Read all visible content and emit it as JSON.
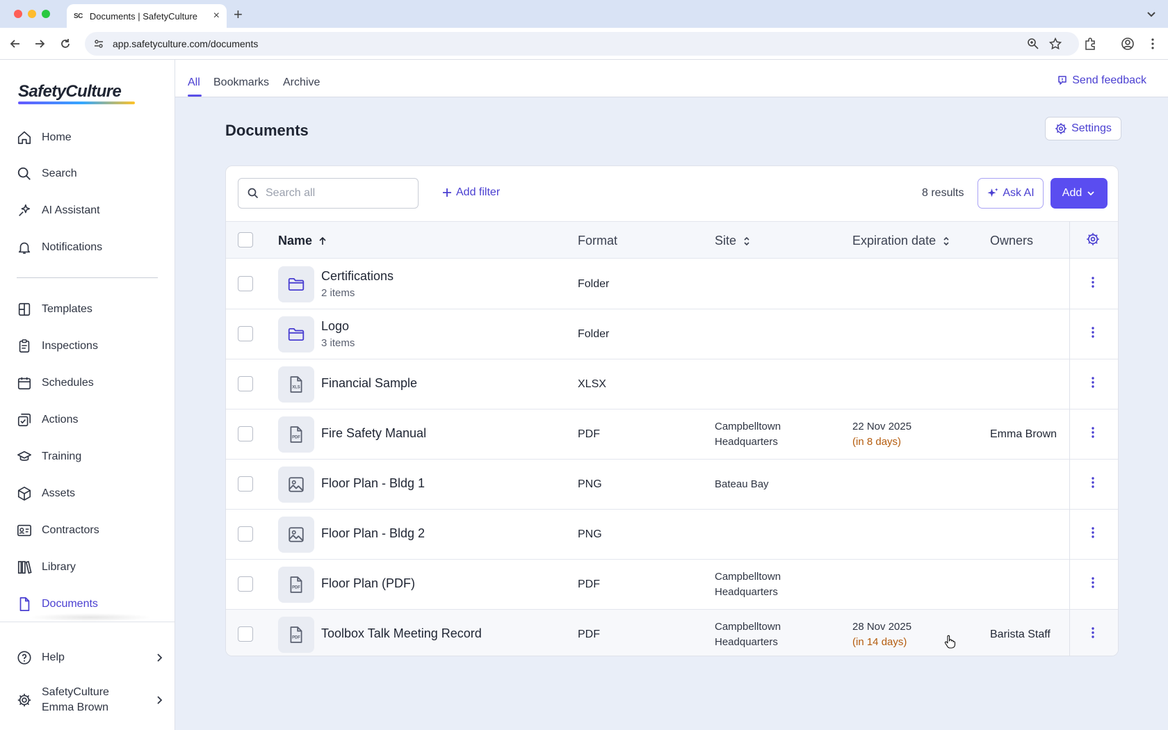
{
  "browser": {
    "tab_title": "Documents | SafetyCulture",
    "favicon_text": "SC",
    "url": "app.safetyculture.com/documents"
  },
  "sidebar": {
    "logo": "SafetyCulture",
    "items": [
      {
        "label": "Home",
        "icon": "home-icon"
      },
      {
        "label": "Search",
        "icon": "search-icon"
      },
      {
        "label": "AI Assistant",
        "icon": "sparkle-icon"
      },
      {
        "label": "Notifications",
        "icon": "bell-icon"
      },
      {
        "label": "Templates",
        "icon": "template-icon"
      },
      {
        "label": "Inspections",
        "icon": "clipboard-icon"
      },
      {
        "label": "Schedules",
        "icon": "calendar-icon"
      },
      {
        "label": "Actions",
        "icon": "action-check-icon"
      },
      {
        "label": "Training",
        "icon": "graduation-cap-icon"
      },
      {
        "label": "Assets",
        "icon": "cube-icon"
      },
      {
        "label": "Contractors",
        "icon": "id-card-icon"
      },
      {
        "label": "Library",
        "icon": "books-icon"
      },
      {
        "label": "Documents",
        "icon": "document-icon",
        "active": true
      }
    ],
    "help": "Help",
    "org_name": "SafetyCulture",
    "user_name": "Emma Brown"
  },
  "tabs": {
    "all": "All",
    "bookmarks": "Bookmarks",
    "archive": "Archive",
    "active": "All"
  },
  "feedback_label": "Send feedback",
  "page": {
    "title": "Documents",
    "settings_label": "Settings"
  },
  "toolbar": {
    "search_placeholder": "Search all",
    "add_filter_label": "Add filter",
    "results_text": "8 results",
    "ask_ai_label": "Ask AI",
    "add_label": "Add"
  },
  "table": {
    "columns": {
      "name": "Name",
      "format": "Format",
      "site": "Site",
      "expiration": "Expiration date",
      "owners": "Owners"
    },
    "sort": {
      "column": "name",
      "direction": "ascending"
    },
    "rows": [
      {
        "name": "Certifications",
        "sub": "2 items",
        "format": "Folder",
        "icon": "folder-icon",
        "site1": "",
        "site2": "",
        "exp_date": "",
        "exp_note": "",
        "owner": ""
      },
      {
        "name": "Logo",
        "sub": "3 items",
        "format": "Folder",
        "icon": "folder-icon",
        "site1": "",
        "site2": "",
        "exp_date": "",
        "exp_note": "",
        "owner": ""
      },
      {
        "name": "Financial Sample",
        "sub": "",
        "format": "XLSX",
        "icon": "xls-file-icon",
        "site1": "",
        "site2": "",
        "exp_date": "",
        "exp_note": "",
        "owner": ""
      },
      {
        "name": "Fire Safety Manual",
        "sub": "",
        "format": "PDF",
        "icon": "pdf-file-icon",
        "site1": "Campbelltown",
        "site2": "Headquarters",
        "exp_date": "22 Nov 2025",
        "exp_note": "(in 8 days)",
        "owner": "Emma Brown"
      },
      {
        "name": "Floor Plan - Bldg 1",
        "sub": "",
        "format": "PNG",
        "icon": "image-icon",
        "site1": "Bateau Bay",
        "site2": "",
        "exp_date": "",
        "exp_note": "",
        "owner": ""
      },
      {
        "name": "Floor Plan - Bldg 2",
        "sub": "",
        "format": "PNG",
        "icon": "image-icon",
        "site1": "",
        "site2": "",
        "exp_date": "",
        "exp_note": "",
        "owner": ""
      },
      {
        "name": "Floor Plan (PDF)",
        "sub": "",
        "format": "PDF",
        "icon": "pdf-file-icon",
        "site1": "Campbelltown",
        "site2": "Headquarters",
        "exp_date": "",
        "exp_note": "",
        "owner": ""
      },
      {
        "name": "Toolbox Talk Meeting Record",
        "sub": "",
        "format": "PDF",
        "icon": "pdf-file-icon",
        "site1": "Campbelltown",
        "site2": "Headquarters",
        "exp_date": "28 Nov 2025",
        "exp_note": "(in 14 days)",
        "owner": "Barista Staff"
      }
    ]
  },
  "colors": {
    "accent": "#4a3fd1",
    "primary_button": "#5a4df0",
    "warning_text": "#b45c0e",
    "page_background": "#e9eef8"
  }
}
